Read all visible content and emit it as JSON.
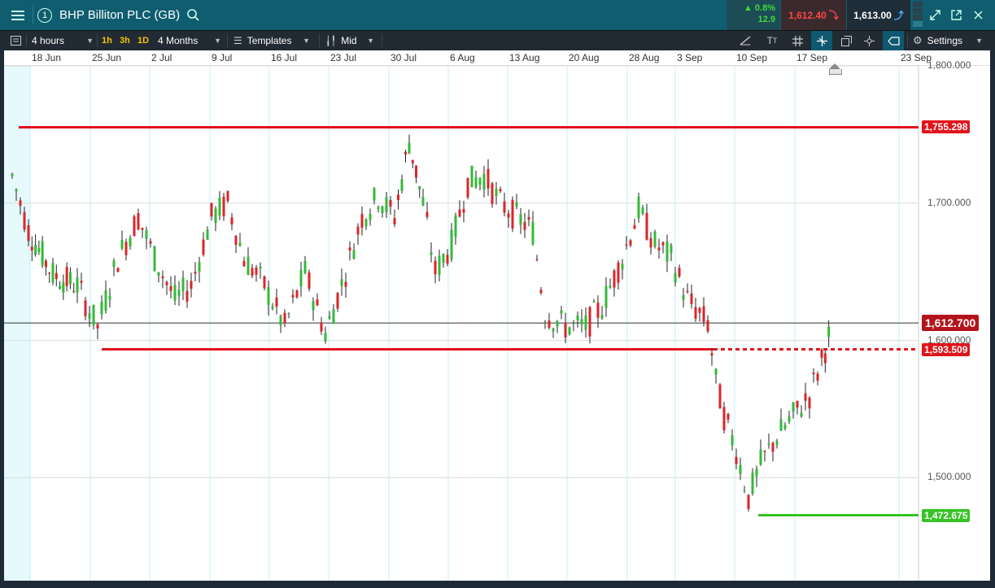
{
  "header": {
    "menu_icon": "hamburger-icon",
    "badge": "1",
    "title": "BHP Billiton PLC (GB)",
    "change_pct": "0.8%",
    "change_pts": "12.9",
    "sell_price": "1,612.40",
    "buy_price": "1,613.00"
  },
  "toolbar": {
    "interval": "4 hours",
    "quick_1h": "1h",
    "quick_3h": "3h",
    "quick_1d": "1D",
    "range": "4 Months",
    "templates": "Templates",
    "price_type": "Mid",
    "settings": "Settings"
  },
  "chart_data": {
    "type": "candlestick",
    "x_ticks": [
      "18 Jun",
      "25 Jun",
      "2 Jul",
      "9 Jul",
      "16 Jul",
      "23 Jul",
      "30 Jul",
      "6 Aug",
      "13 Aug",
      "20 Aug",
      "28 Aug",
      "3 Sep",
      "10 Sep",
      "17 Sep",
      "23 Sep"
    ],
    "y_ticks": [
      "1,800.000",
      "1,700.000",
      "1,600.000",
      "1,500.000"
    ],
    "ylim": [
      1425,
      1800
    ],
    "current_price": "1,612.700",
    "horizontal_lines": [
      {
        "label": "1,755.298",
        "value": 1755.298,
        "color": "#e0141c"
      },
      {
        "label": "1,593.509",
        "value": 1593.509,
        "color": "#e0141c"
      },
      {
        "label": "1,472.675",
        "value": 1472.675,
        "color": "#35c424"
      }
    ],
    "up_color": "#35b83a",
    "down_color": "#d9262a"
  }
}
